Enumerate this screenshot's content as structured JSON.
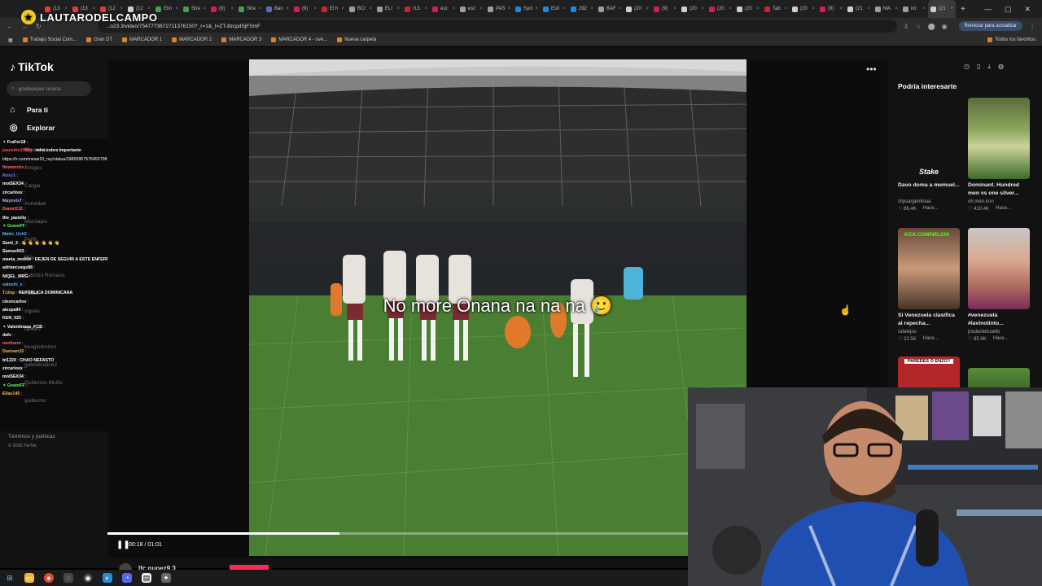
{
  "overlay_logo": "LAUTARODELCAMPO",
  "browser": {
    "tabs": [
      {
        "label": "(13",
        "color": "#e53935"
      },
      {
        "label": "(13",
        "color": "#e53935"
      },
      {
        "label": "(12",
        "color": "#e53935"
      },
      {
        "label": "(12",
        "color": "#cfcfcf"
      },
      {
        "label": "Elin",
        "color": "#43a047"
      },
      {
        "label": "Stre",
        "color": "#43a047"
      },
      {
        "label": "(9)",
        "color": "#d81b60"
      },
      {
        "label": "Stre",
        "color": "#43a047"
      },
      {
        "label": "Ban",
        "color": "#5c6bc0"
      },
      {
        "label": "(9)",
        "color": "#d81b60"
      },
      {
        "label": "El h",
        "color": "#c62828"
      },
      {
        "label": "BC/",
        "color": "#9e9e9e"
      },
      {
        "label": "EL/",
        "color": "#9e9e9e"
      },
      {
        "label": "r13",
        "color": "#c62828"
      },
      {
        "label": "est:",
        "color": "#d81b60"
      },
      {
        "label": "est:",
        "color": "#9e9e9e"
      },
      {
        "label": "PAS",
        "color": "#9e9e9e"
      },
      {
        "label": "Sycl",
        "color": "#1e88e5"
      },
      {
        "label": "Esti",
        "color": "#1e88e5"
      },
      {
        "label": "292",
        "color": "#1e88e5"
      },
      {
        "label": "BAF",
        "color": "#9e9e9e"
      },
      {
        "label": "(20",
        "color": "#cfcfcf"
      },
      {
        "label": "(9)",
        "color": "#d81b60"
      },
      {
        "label": "(20",
        "color": "#cfcfcf"
      },
      {
        "label": "(20",
        "color": "#d81b60"
      },
      {
        "label": "(20",
        "color": "#cfcfcf"
      },
      {
        "label": "Tab",
        "color": "#c62828"
      },
      {
        "label": "(20",
        "color": "#cfcfcf"
      },
      {
        "label": "(9)",
        "color": "#d81b60"
      },
      {
        "label": "(21",
        "color": "#cfcfcf"
      },
      {
        "label": "MA",
        "color": "#9e9e9e"
      },
      {
        "label": "im:",
        "color": "#9e9e9e"
      },
      {
        "label": "(21",
        "color": "#cfcfcf"
      }
    ],
    "url": "...o23.3/video/7547773672711376150?_r=1&_t=ZT-8zcpdSjFSmF",
    "update_button": "Reiniciar para actualizar",
    "bookmarks": [
      "Trabajo Social Com...",
      "Gran DT",
      "MARCADOR 1",
      "MARCADOR 2",
      "MARCADOR 3",
      "MARCADOR 4 - ove...",
      "Nueva carpeta"
    ],
    "all_bookmarks": "Todos los favoritos"
  },
  "tiktok": {
    "logo": "TikTok",
    "search_placeholder": "goalkeeper onana",
    "nav": [
      {
        "label": "Para ti",
        "icon": "home-icon"
      },
      {
        "label": "Explorar",
        "icon": "compass-icon"
      }
    ],
    "footer": [
      "Términos y políticas",
      "© 2025 TikTok"
    ],
    "caption": "No more Onana na na na 🥲",
    "time": "00:18 / 01:01",
    "progress": 0.4,
    "author": "Ifc.nunez9.3",
    "rec_title": "Podría interesarte",
    "recs": [
      {
        "title": "Davo doma a memuel...",
        "author": "clipsargentinaa",
        "likes": "86.4K",
        "date": "Hace..."
      },
      {
        "title": "Dominant. Hundred men vs one silver...",
        "author": "oh.men.iron",
        "likes": "410.4K",
        "date": "Hace..."
      },
      {
        "title": "Si Venezuela clasifica al repecha...",
        "author": "rafalejov",
        "likes": "22.5K",
        "date": "Hace..."
      },
      {
        "title": "#venezuela #lavinotinto...",
        "author": "josdanielcoello",
        "likes": "85.9K",
        "date": "Hace..."
      }
    ],
    "thumb_texts": {
      "stake": "Stake",
      "kick": "KICK.COM/NELGIN",
      "paredes": "PAREDES O ENZO?"
    }
  },
  "chat": [
    {
      "user": "FraFer18",
      "text": "",
      "color": "#ffffff",
      "badge": true
    },
    {
      "user": "juansitio1988x",
      "text": "mira cobra importante",
      "color": "#ff4d4d"
    },
    {
      "user": "",
      "text": "https://x.com/messi10_rey/status/1965596757645279678",
      "color": "#ffffff"
    },
    {
      "user": "finwmrcks",
      "text": "",
      "color": "#ff6b6b"
    },
    {
      "user": "Roxy1",
      "text": "",
      "color": "#7b7bff"
    },
    {
      "user": "moiSEX34",
      "text": "",
      "color": "#ffffff"
    },
    {
      "user": "zircarlosx",
      "text": "",
      "color": "#ffffff"
    },
    {
      "user": "Mayoslx7",
      "text": "",
      "color": "#c9a0ff"
    },
    {
      "user": "Daniel215",
      "text": "",
      "color": "#ff6b6b"
    },
    {
      "user": "the_panelis",
      "text": "",
      "color": "#ffffff"
    },
    {
      "user": "GreenFF",
      "text": "",
      "color": "#6bff6b",
      "badge": true
    },
    {
      "user": "Matin_Uch2",
      "text": "",
      "color": "#5ab4ff"
    },
    {
      "user": "Santi_3",
      "text": "👋 👋 👋 👋 👋 👋",
      "color": "#ffffff"
    },
    {
      "user": "Samuu003",
      "text": "",
      "color": "#ffffff"
    },
    {
      "user": "mania_mobile",
      "text": "DEJEN DE SEGUIR A ESTE ENFERMO 😂 😂 😂",
      "color": "#ffffff"
    },
    {
      "user": "adriancuegs88",
      "text": "",
      "color": "#ffffff"
    },
    {
      "user": "NIQEL_MRG",
      "text": "",
      "color": "#ffffff"
    },
    {
      "user": "satoshi_s",
      "text": "",
      "color": "#5ab4ff"
    },
    {
      "user": "Tz3np",
      "text": "REPÚBLICA DOMINICANA",
      "color": "#ffb84d"
    },
    {
      "user": "cleoncarlox",
      "text": "",
      "color": "#ffffff"
    },
    {
      "user": "alexpa94",
      "text": "",
      "color": "#ffffff"
    },
    {
      "user": "KEN_023",
      "text": "",
      "color": "#ffffff"
    },
    {
      "user": "Valentinaaa_FCB",
      "text": "",
      "color": "#ffffff",
      "badge": true
    },
    {
      "user": "dafz",
      "text": "",
      "color": "#ffffff"
    },
    {
      "user": "neohurm",
      "text": "",
      "color": "#ff6b6b"
    },
    {
      "user": "Davivan15",
      "text": "",
      "color": "#ffb84d"
    },
    {
      "user": "bt1220",
      "text": "CHAO NEFASTO",
      "color": "#ffffff"
    },
    {
      "user": "zircarlosx",
      "text": "",
      "color": "#ffffff"
    },
    {
      "user": "moiSEX34",
      "text": "",
      "color": "#ffffff"
    },
    {
      "user": "GreenFF",
      "text": "",
      "color": "#6bff6b",
      "badge": true
    },
    {
      "user": "Ellas145",
      "text": "",
      "color": "#ffb84d"
    }
  ],
  "chat_ghost": [
    "Siguiendo",
    "Amigos",
    "Cargar",
    "Actividad",
    "Mensajes",
    "Perfil",
    "Más",
    "Fabrizio Romano",
    "Iniciar",
    "sigues",
    "lautaro",
    "beagio4mirez",
    "gabrielcaline2",
    "Guillermo Muñiz",
    "guillermo"
  ]
}
